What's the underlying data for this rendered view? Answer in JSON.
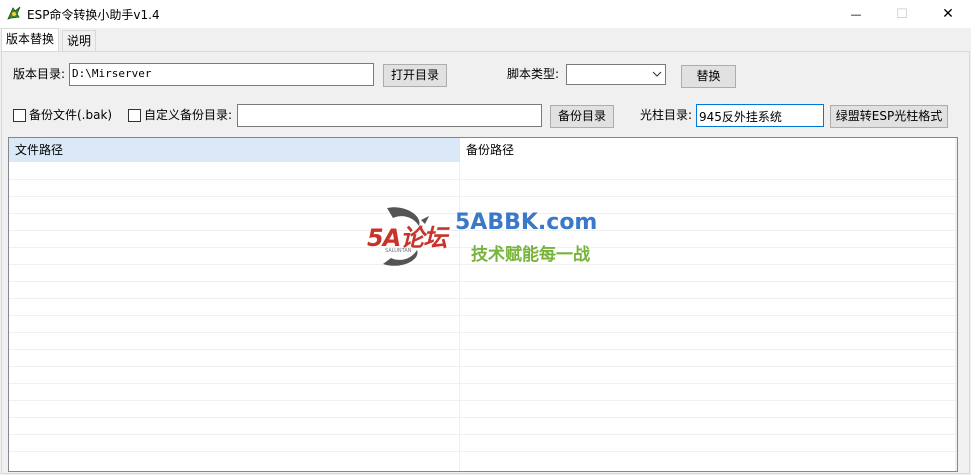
{
  "window": {
    "title": "ESP命令转换小助手v1.4",
    "minimize_glyph": "—",
    "maximize_glyph": "☐",
    "close_glyph": "✕"
  },
  "tabs": [
    {
      "label": "版本替换",
      "active": true
    },
    {
      "label": "说明",
      "active": false
    }
  ],
  "form": {
    "version_dir_label": "版本目录:",
    "version_dir_value": "D:\\Mirserver",
    "open_dir_button": "打开目录",
    "script_type_label": "脚本类型:",
    "script_type_value": "",
    "replace_button": "替换",
    "backup_file_checkbox": "备份文件(.bak)",
    "backup_file_checked": false,
    "custom_backup_checkbox": "自定义备份目录:",
    "custom_backup_checked": false,
    "custom_backup_value": "",
    "backup_dir_button": "备份目录",
    "light_pillar_label": "光柱目录:",
    "light_pillar_value": "945反外挂系统",
    "convert_button": "绿盟转ESP光柱格式"
  },
  "table": {
    "columns": [
      "文件路径",
      "备份路径"
    ],
    "rows": []
  },
  "watermark": {
    "logo_text": "5A论坛",
    "logo_subtext": "SALUNTAN",
    "site": "5ABBK.com",
    "slogan": "技术赋能每一战"
  },
  "colors": {
    "header_highlight": "#dbe8f7",
    "focus_border": "#0078d7",
    "logo_red": "#c8342a",
    "site_blue": "#3a78c8",
    "slogan_green": "#78b43c"
  }
}
